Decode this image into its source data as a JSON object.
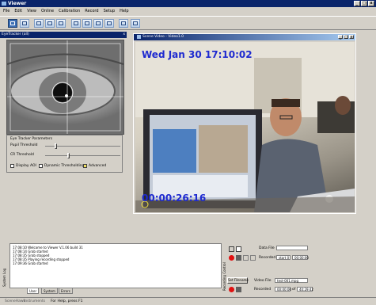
{
  "window": {
    "title": "Viewer",
    "min": "_",
    "max": "□",
    "close": "x"
  },
  "menu": [
    "File",
    "Edit",
    "View",
    "Online",
    "Calibration",
    "Record",
    "Setup",
    "Help"
  ],
  "toolbar": {
    "active_index": 0,
    "count": 12
  },
  "eye_panel": {
    "title": "EyeTracker (all)",
    "close": "x",
    "params_title": "Eye Tracker Parameters",
    "pupil_threshold": "Pupil Threshold",
    "cr_threshold": "CR Threshold",
    "display_aoi": "Display AOI",
    "dynamic_thresholding": "Dynamic Thresholding",
    "advanced": "Advanced"
  },
  "video_window": {
    "title": "Scene Video - Video1.0",
    "datetime_overlay": "Wed Jan 30 17:10:02",
    "timecode_overlay": "00:00:26:16"
  },
  "log": {
    "side_label": "System Log",
    "lines": [
      "17:08:10  Welcome to Viewer V.1.06 build 31",
      "17:08:14  Grab started",
      "17:08:35  Grab stopped",
      "17:08:35  Playing recording stopped",
      "17:09:36  Grab started"
    ],
    "tabs": [
      "User",
      "System",
      "Errors"
    ]
  },
  "recording": {
    "side_label": "Recording Control",
    "data_file_label": "Data File",
    "data_recorded_label": "Recorded",
    "data_recorded_value": "start 0",
    "data_time": "00:00:00",
    "set_filename": "Set Filename",
    "video_file_label": "Video File",
    "video_file_value": "test-001.mpg",
    "video_recorded_label": "Recorded",
    "video_time": "00:00:00",
    "video_of": "of",
    "video_total": "40:29:42"
  },
  "statusbar": {
    "tabs": [
      "SceneHawk",
      "Instruments"
    ],
    "help_text": "For Help, press F1"
  },
  "colors": {
    "title_bg": "#0a246a",
    "overlay_text": "#1e2ad0",
    "record_red": "#e01010"
  }
}
